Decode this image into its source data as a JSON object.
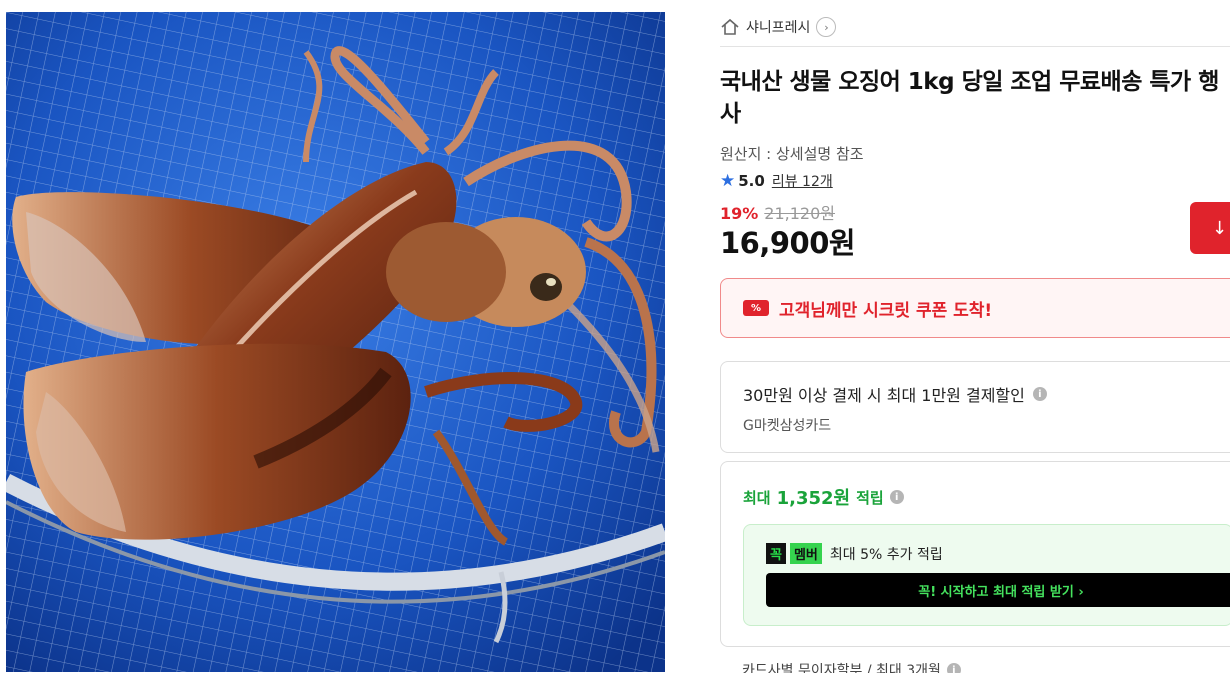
{
  "store": {
    "name": "샤니프레시",
    "home_icon": "home-icon",
    "chevron": "›"
  },
  "product": {
    "title": "국내산 생물 오징어 1kg 당일 조업 무료배송 특가 행사",
    "origin": "원산지 : 상세설명 참조",
    "rating": "5.0",
    "review_link": "리뷰 12개",
    "discount": "19%",
    "original_price": "21,120원",
    "price": "16,900원",
    "download_icon": "↓"
  },
  "coupon": {
    "badge": "%",
    "text": "고객님께만 시크릿 쿠폰 도착!"
  },
  "card_benefit": {
    "title": "30만원 이상 결제 시 최대 1만원 결제할인",
    "card": "G마켓삼성카드",
    "info_icon": "i"
  },
  "points": {
    "prefix": "최대",
    "amount": "1,352원",
    "suffix": "적립",
    "info_icon": "i",
    "member_badge_1": "꼭",
    "member_badge_2": "멤버",
    "member_text": "최대 5% 추가 적립",
    "start_button": "꼭! 시작하고 최대 적립 받기  ›"
  },
  "installment": {
    "text": "카드사별 무이자할부 / 최대 3개월",
    "info_icon": "i"
  },
  "colors": {
    "accent_red": "#e0232c",
    "accent_green": "#1aa33a",
    "star_blue": "#2d6fe0"
  }
}
